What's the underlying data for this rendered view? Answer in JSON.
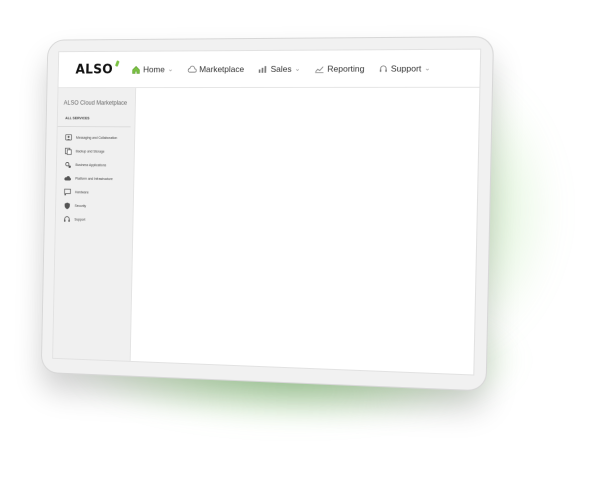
{
  "brand": {
    "logo_text": "ALSO",
    "accent_color": "#7ac143"
  },
  "topnav": {
    "items": [
      {
        "label": "Home",
        "icon": "home-icon",
        "has_dropdown": true
      },
      {
        "label": "Marketplace",
        "icon": "cloud-icon",
        "has_dropdown": false
      },
      {
        "label": "Sales",
        "icon": "sales-icon",
        "has_dropdown": true
      },
      {
        "label": "Reporting",
        "icon": "chart-icon",
        "has_dropdown": false
      },
      {
        "label": "Support",
        "icon": "support-icon",
        "has_dropdown": true
      }
    ]
  },
  "sidebar": {
    "title": "ALSO Cloud Marketplace",
    "section": "ALL SERVICES",
    "items": [
      {
        "label": "Messaging and Collaboration",
        "icon": "messaging-icon"
      },
      {
        "label": "Backup and Storage",
        "icon": "storage-icon"
      },
      {
        "label": "Business Applications",
        "icon": "applications-icon"
      },
      {
        "label": "Platform and Infrastructure",
        "icon": "cloud-platform-icon"
      },
      {
        "label": "Hardware",
        "icon": "hardware-icon"
      },
      {
        "label": "Security",
        "icon": "shield-icon"
      },
      {
        "label": "Support",
        "icon": "support-icon"
      }
    ]
  }
}
